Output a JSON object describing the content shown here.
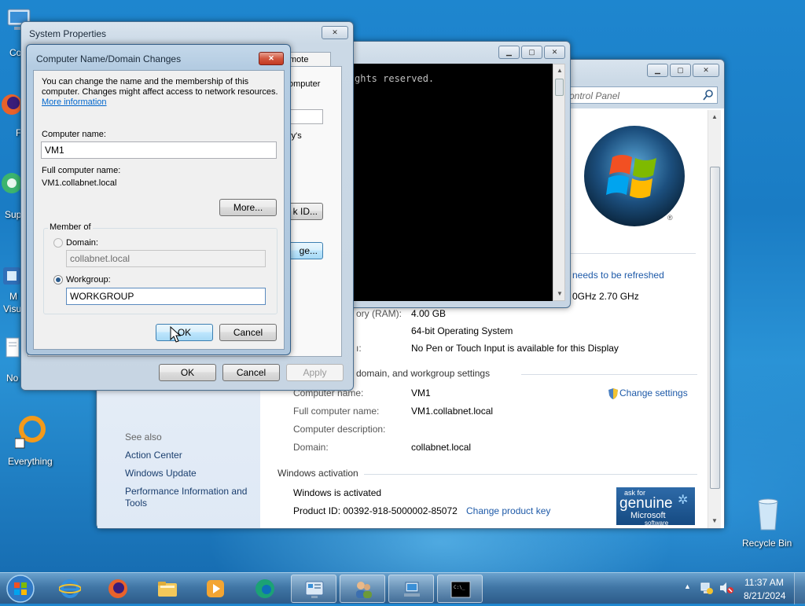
{
  "desktop": {
    "icons": [
      {
        "label": "Co"
      },
      {
        "label": "F"
      },
      {
        "label": "Sup"
      },
      {
        "label": "M"
      },
      {
        "label": "Visu"
      },
      {
        "label": "No"
      },
      {
        "label": "Everything"
      },
      {
        "label": "Recycle Bin"
      }
    ]
  },
  "control_panel": {
    "search_placeholder": "ontrol Panel",
    "refresh_notice": "needs to be refreshed",
    "cpu_speed": "0GHz   2.70 GHz",
    "ram_label": "ory (RAM):",
    "ram_value": "4.00 GB",
    "system_type_value": "64-bit Operating System",
    "pen_label": "ı:",
    "pen_value": "No Pen or Touch Input is available for this Display",
    "section_computer": "domain, and workgroup settings",
    "computer_name_label": "Computer name:",
    "computer_name_value": "VM1",
    "full_name_label": "Full computer name:",
    "full_name_value": "VM1.collabnet.local",
    "description_label": "Computer description:",
    "domain_label": "Domain:",
    "domain_value": "collabnet.local",
    "change_settings": "Change settings",
    "section_activation": "Windows activation",
    "activated": "Windows is activated",
    "product_id": "Product ID: 00392-918-5000002-85072",
    "change_key": "Change product key",
    "see_also": "See also",
    "see_also_links": [
      "Action Center",
      "Windows Update",
      "Performance Information and Tools"
    ],
    "genuine": {
      "line1": "ask for",
      "line2": "genuine",
      "line3": "Microsoft",
      "line4": "software"
    }
  },
  "cmd": {
    "text": "ghts reserved."
  },
  "system_properties": {
    "title": "System Properties",
    "tab_remote": "mote",
    "bg_text1": "omputer",
    "bg_text2": "ry's",
    "network_id_btn": "k ID...",
    "change_btn": "ge...",
    "ok": "OK",
    "cancel": "Cancel",
    "apply": "Apply"
  },
  "dialog": {
    "title": "Computer Name/Domain Changes",
    "intro_line1": "You can change the name and the membership of this",
    "intro_line2": "computer. Changes might affect access to network resources.",
    "more_info": "More information",
    "computer_name_label": "Computer name:",
    "computer_name_value": "VM1",
    "full_name_label": "Full computer name:",
    "full_name_value": "VM1.collabnet.local",
    "more_button": "More...",
    "member_of": "Member of",
    "domain_label": "Domain:",
    "domain_value": "collabnet.local",
    "workgroup_label": "Workgroup:",
    "workgroup_value": "WORKGROUP",
    "ok": "OK",
    "cancel": "Cancel",
    "selected": "workgroup"
  },
  "tray": {
    "time": "11:37 AM",
    "date": "8/21/2024"
  },
  "taskbar": {
    "apps": [
      "start",
      "internet-explorer",
      "firefox",
      "explorer",
      "media-player",
      "edge",
      "control-panel",
      "users",
      "network",
      "cmd"
    ]
  },
  "colors": {
    "accent": "#1e5aa8",
    "close_red": "#c23a22"
  }
}
